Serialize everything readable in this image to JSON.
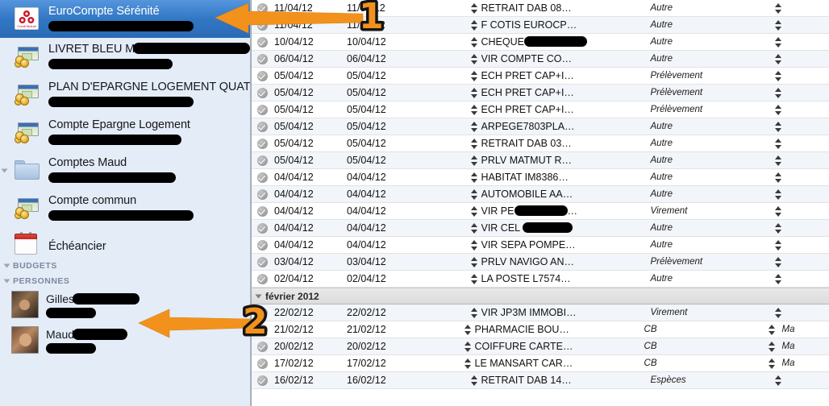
{
  "sidebar": {
    "accounts": [
      {
        "label": "EuroCompte Sérénité",
        "icon": "bank-logo-icon",
        "selected": true
      },
      {
        "label": "LIVRET BLEU M",
        "icon": "money-icon",
        "selected": false
      },
      {
        "label": "PLAN D'EPARGNE LOGEMENT QUATT…",
        "icon": "money-icon",
        "selected": false
      },
      {
        "label": "Compte Epargne Logement",
        "icon": "money-icon",
        "selected": false
      },
      {
        "label": "Comptes Maud",
        "icon": "folder-icon",
        "selected": false
      },
      {
        "label": "Compte commun",
        "icon": "money-icon",
        "selected": false
      },
      {
        "label": "Échéancier",
        "icon": "calendar-icon",
        "selected": false
      }
    ],
    "sections": [
      {
        "label": "BUDGETS"
      },
      {
        "label": "PERSONNES"
      }
    ],
    "persons": [
      {
        "name": "Gilles",
        "avatar": "avatar-gilles"
      },
      {
        "name": "Maud",
        "avatar": "avatar-maud"
      }
    ]
  },
  "table": {
    "rows": [
      {
        "kind": "txn",
        "checked": true,
        "date1": "11/04/12",
        "date2": "11/04/12",
        "desc": "RETRAIT DAB 08…",
        "mode": "Autre",
        "tail": ""
      },
      {
        "kind": "txn",
        "checked": true,
        "date1": "11/04/12",
        "date2": "11/04/12",
        "desc": "F COTIS EUROCP…",
        "mode": "Autre",
        "tail": ""
      },
      {
        "kind": "txn",
        "checked": true,
        "date1": "10/04/12",
        "date2": "10/04/12",
        "desc": "CHEQUE",
        "desc_redacted": 78,
        "mode": "Autre",
        "tail": ""
      },
      {
        "kind": "txn",
        "checked": true,
        "date1": "06/04/12",
        "date2": "06/04/12",
        "desc": "VIR COMPTE CO…",
        "mode": "Autre",
        "tail": ""
      },
      {
        "kind": "txn",
        "checked": true,
        "date1": "05/04/12",
        "date2": "05/04/12",
        "desc": "ECH PRET CAP+I…",
        "mode": "Prélèvement",
        "tail": ""
      },
      {
        "kind": "txn",
        "checked": true,
        "date1": "05/04/12",
        "date2": "05/04/12",
        "desc": "ECH PRET CAP+I…",
        "mode": "Prélèvement",
        "tail": ""
      },
      {
        "kind": "txn",
        "checked": true,
        "date1": "05/04/12",
        "date2": "05/04/12",
        "desc": "ECH PRET CAP+I…",
        "mode": "Prélèvement",
        "tail": ""
      },
      {
        "kind": "txn",
        "checked": true,
        "date1": "05/04/12",
        "date2": "05/04/12",
        "desc": "ARPEGE7803PLA…",
        "mode": "Autre",
        "tail": ""
      },
      {
        "kind": "txn",
        "checked": true,
        "date1": "05/04/12",
        "date2": "05/04/12",
        "desc": "RETRAIT DAB 03…",
        "mode": "Autre",
        "tail": ""
      },
      {
        "kind": "txn",
        "checked": true,
        "date1": "05/04/12",
        "date2": "05/04/12",
        "desc": "PRLV MATMUT R…",
        "mode": "Autre",
        "tail": ""
      },
      {
        "kind": "txn",
        "checked": true,
        "date1": "04/04/12",
        "date2": "04/04/12",
        "desc": "HABITAT IM8386…",
        "mode": "Autre",
        "tail": ""
      },
      {
        "kind": "txn",
        "checked": true,
        "date1": "04/04/12",
        "date2": "04/04/12",
        "desc": "AUTOMOBILE AA…",
        "mode": "Autre",
        "tail": ""
      },
      {
        "kind": "txn",
        "checked": true,
        "date1": "04/04/12",
        "date2": "04/04/12",
        "desc": "VIR PE",
        "desc_redacted": 66,
        "desc_suffix": "…",
        "mode": "Virement",
        "tail": ""
      },
      {
        "kind": "txn",
        "checked": true,
        "date1": "04/04/12",
        "date2": "04/04/12",
        "desc": "VIR CEL ",
        "desc_redacted": 62,
        "mode": "Autre",
        "tail": ""
      },
      {
        "kind": "txn",
        "checked": true,
        "date1": "04/04/12",
        "date2": "04/04/12",
        "desc": "VIR SEPA POMPE…",
        "mode": "Autre",
        "tail": ""
      },
      {
        "kind": "txn",
        "checked": true,
        "date1": "03/04/12",
        "date2": "03/04/12",
        "desc": "PRLV NAVIGO AN…",
        "mode": "Prélèvement",
        "tail": ""
      },
      {
        "kind": "txn",
        "checked": true,
        "date1": "02/04/12",
        "date2": "02/04/12",
        "desc": "LA POSTE L7574…",
        "mode": "Autre",
        "tail": ""
      },
      {
        "kind": "group",
        "label": "février 2012"
      },
      {
        "kind": "txn",
        "checked": true,
        "date1": "22/02/12",
        "date2": "22/02/12",
        "desc": "VIR JP3M IMMOBI…",
        "mode": "Virement",
        "tail": ""
      },
      {
        "kind": "txn",
        "checked": true,
        "date1": "21/02/12",
        "date2": "21/02/12",
        "desc": "PHARMACIE BOU…",
        "mode": "CB",
        "tail": "Ma"
      },
      {
        "kind": "txn",
        "checked": true,
        "date1": "20/02/12",
        "date2": "20/02/12",
        "desc": "COIFFURE CARTE…",
        "mode": "CB",
        "tail": "Ma"
      },
      {
        "kind": "txn",
        "checked": true,
        "date1": "17/02/12",
        "date2": "17/02/12",
        "desc": "LE MANSART CAR…",
        "mode": "CB",
        "tail": "Ma"
      },
      {
        "kind": "txn",
        "checked": true,
        "date1": "16/02/12",
        "date2": "16/02/12",
        "desc": "RETRAIT DAB 14…",
        "mode": "Espèces",
        "tail": ""
      }
    ]
  },
  "annotations": {
    "badges": [
      {
        "label": "1"
      },
      {
        "label": "2"
      }
    ],
    "arrow_color": "#F2921D"
  }
}
